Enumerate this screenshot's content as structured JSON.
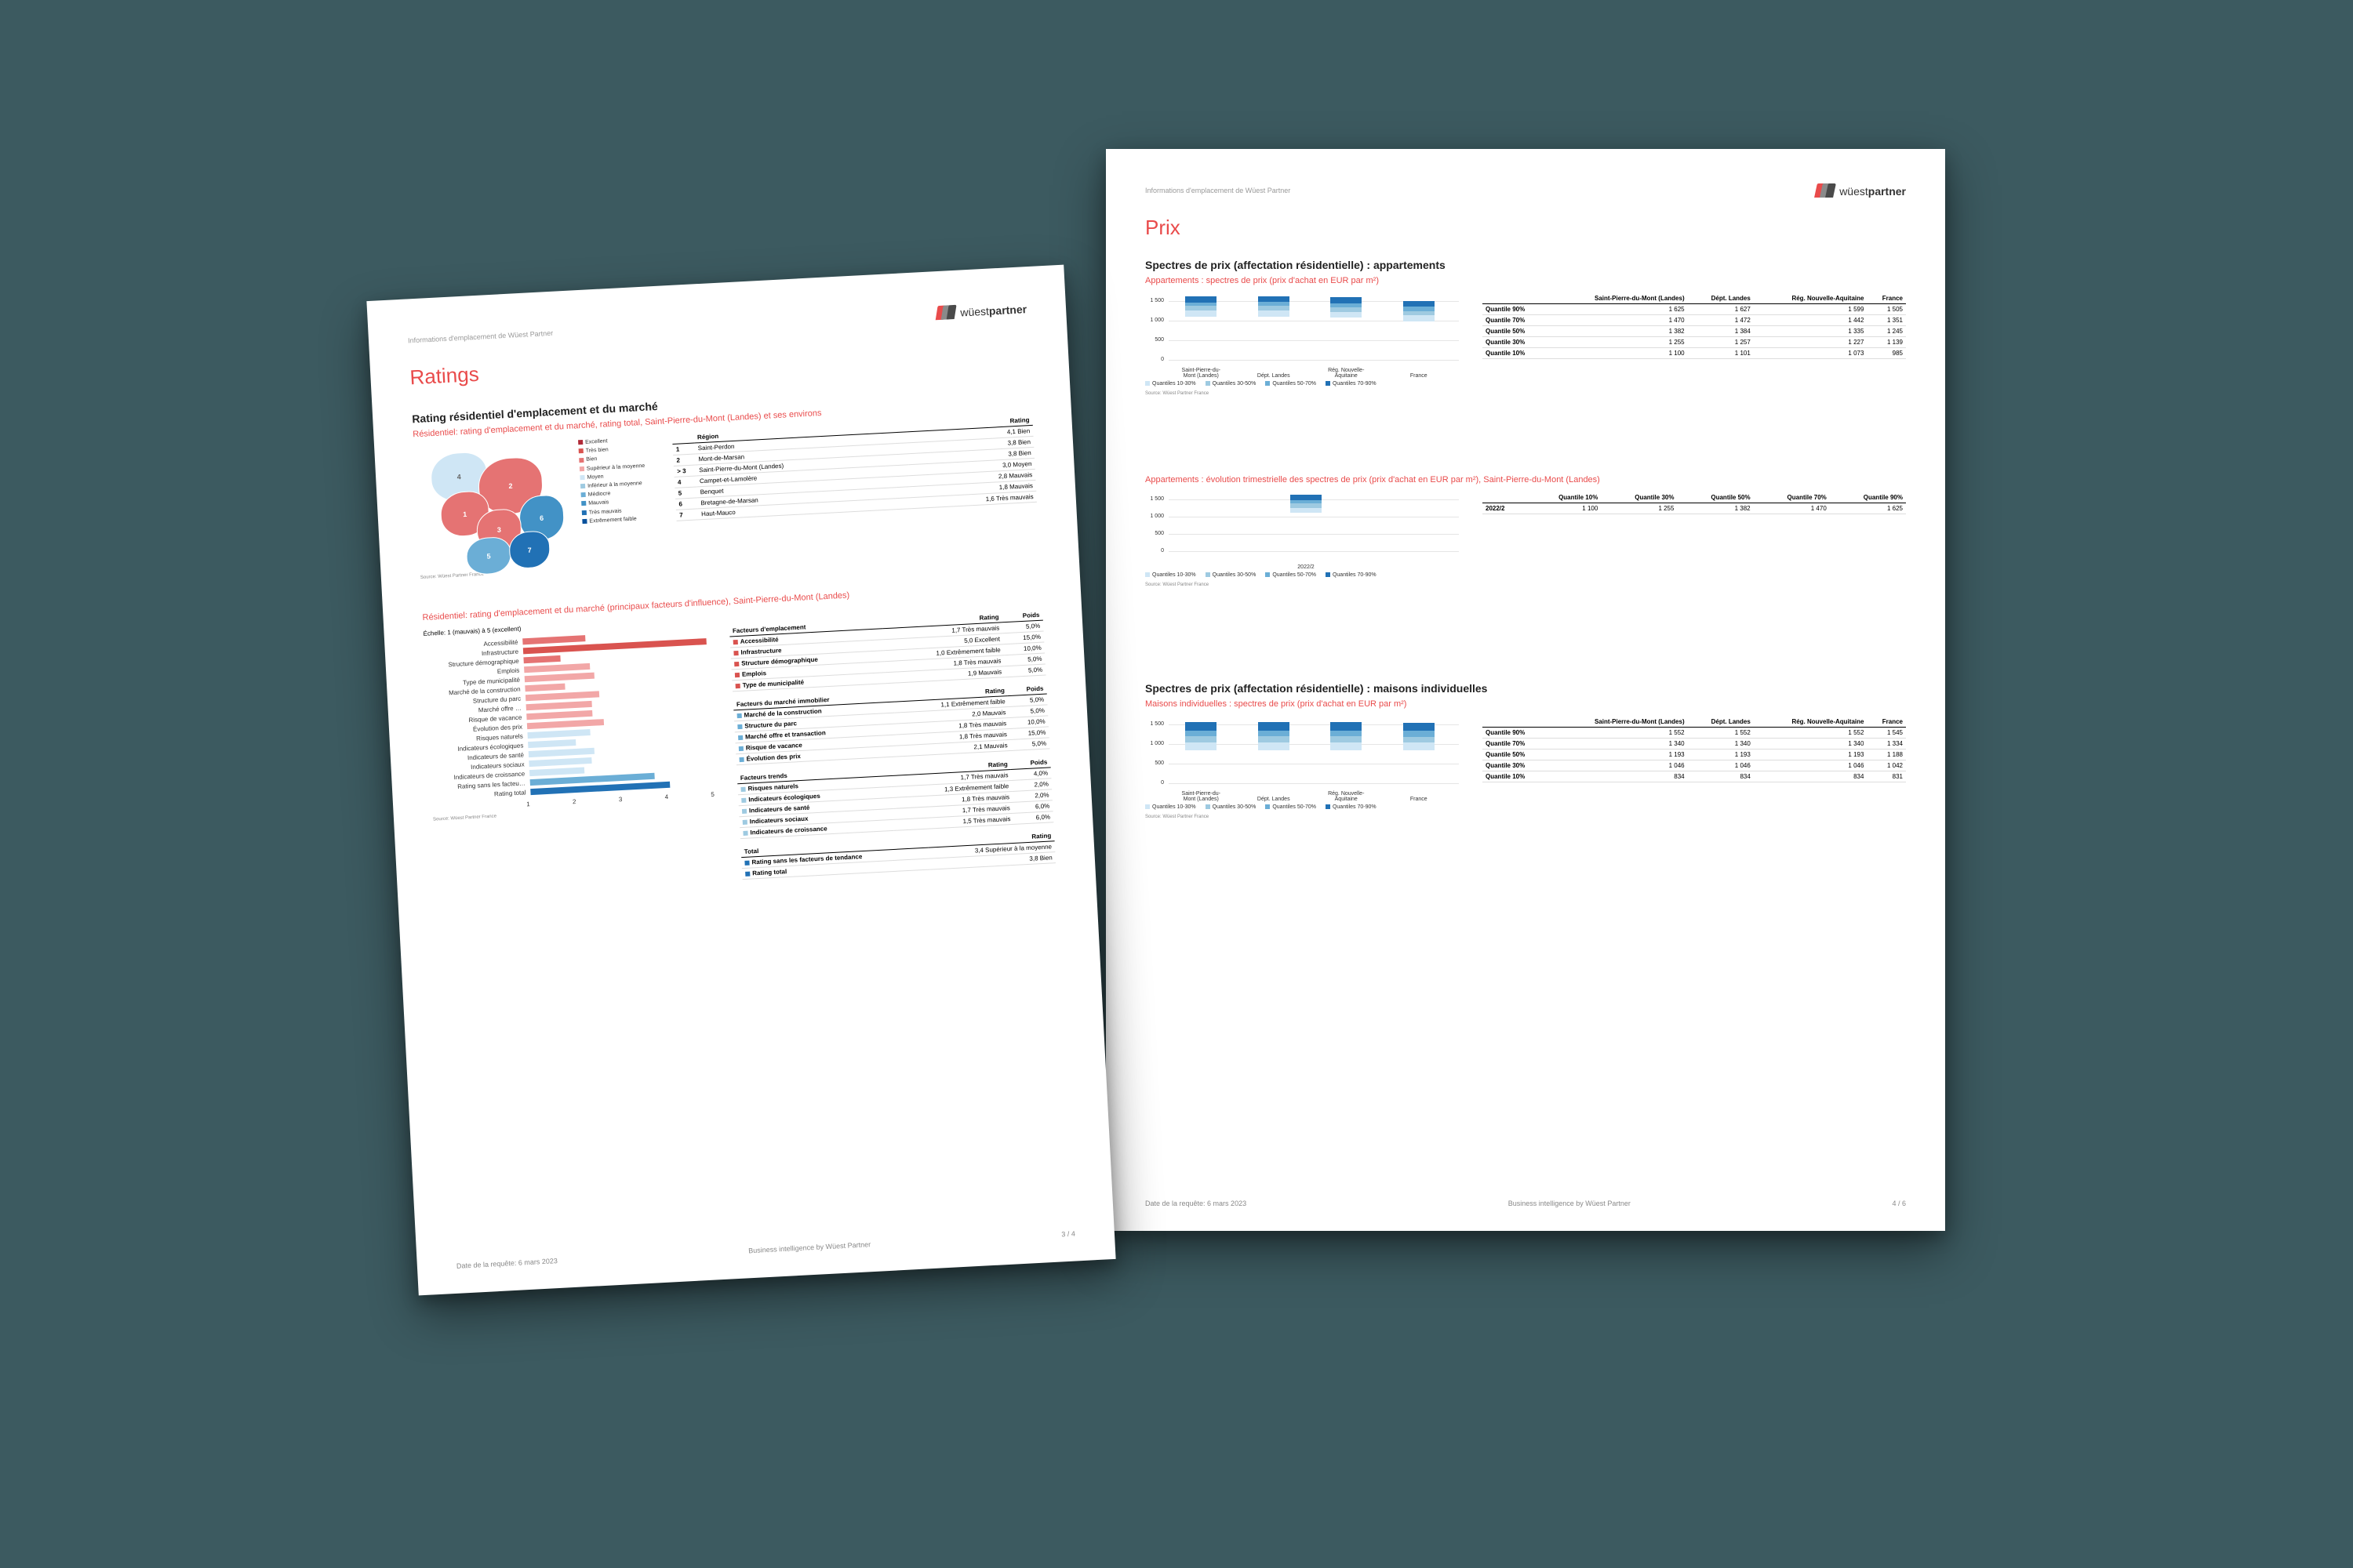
{
  "brand": {
    "name_light": "wüest",
    "name_bold": "partner"
  },
  "page1": {
    "header_note": "Informations d'emplacement de Wüest Partner",
    "title": "Ratings",
    "sec1_h2": "Rating résidentiel d'emplacement et du marché",
    "sec1_h3": "Résidentiel: rating d'emplacement et du marché, rating total, Saint-Pierre-du-Mont (Landes) et ses environs",
    "map_legend": [
      {
        "c": "#b02a37",
        "l": "Excellent"
      },
      {
        "c": "#d9534f",
        "l": "Très bien"
      },
      {
        "c": "#e57373",
        "l": "Bien"
      },
      {
        "c": "#f2a7a7",
        "l": "Supérieur à la moyenne"
      },
      {
        "c": "#cfe6f5",
        "l": "Moyen"
      },
      {
        "c": "#9ecae1",
        "l": "Inférieur à la moyenne"
      },
      {
        "c": "#6baed6",
        "l": "Médiocre"
      },
      {
        "c": "#4292c6",
        "l": "Mauvais"
      },
      {
        "c": "#2171b5",
        "l": "Très mauvais"
      },
      {
        "c": "#08519c",
        "l": "Extrêmement faible"
      }
    ],
    "region_table": {
      "cols": [
        "",
        "Région",
        "Rating"
      ],
      "rows": [
        [
          "1",
          "Saint-Perdon",
          "4,1 Bien"
        ],
        [
          "2",
          "Mont-de-Marsan",
          "3,8 Bien"
        ],
        [
          "> 3",
          "Saint-Pierre-du-Mont (Landes)",
          "3,8 Bien"
        ],
        [
          "4",
          "Campet-et-Lamolère",
          "3,0 Moyen"
        ],
        [
          "5",
          "Benquet",
          "2,8 Mauvais"
        ],
        [
          "6",
          "Bretagne-de-Marsan",
          "1,8 Mauvais"
        ],
        [
          "7",
          "Haut-Mauco",
          "1,6 Très mauvais"
        ]
      ]
    },
    "source": "Source: Wüest Partner France",
    "sec2_h3": "Résidentiel: rating d'emplacement et du marché (principaux facteurs d'influence), Saint-Pierre-du-Mont (Landes)",
    "scale_note": "Échelle: 1 (mauvais) à 5 (excellent)",
    "hbars": [
      {
        "l": "Accessibilité",
        "v": 1.7,
        "c": "#e57373"
      },
      {
        "l": "Infrastructure",
        "v": 5.0,
        "c": "#d9534f"
      },
      {
        "l": "Structure démographique",
        "v": 1.0,
        "c": "#e57373"
      },
      {
        "l": "Emplois",
        "v": 1.8,
        "c": "#f2a7a7"
      },
      {
        "l": "Type de municipalité",
        "v": 1.9,
        "c": "#f2a7a7"
      },
      {
        "l": "Marché de la construction",
        "v": 1.1,
        "c": "#f2a7a7"
      },
      {
        "l": "Structure du parc",
        "v": 2.0,
        "c": "#f2a7a7"
      },
      {
        "l": "Marché offre …",
        "v": 1.8,
        "c": "#f2a7a7"
      },
      {
        "l": "Risque de vacance",
        "v": 1.8,
        "c": "#f2a7a7"
      },
      {
        "l": "Évolution des prix",
        "v": 2.1,
        "c": "#f2a7a7"
      },
      {
        "l": "Risques naturels",
        "v": 1.7,
        "c": "#cfe6f5"
      },
      {
        "l": "Indicateurs écologiques",
        "v": 1.3,
        "c": "#cfe6f5"
      },
      {
        "l": "Indicateurs de santé",
        "v": 1.8,
        "c": "#cfe6f5"
      },
      {
        "l": "Indicateurs sociaux",
        "v": 1.7,
        "c": "#cfe6f5"
      },
      {
        "l": "Indicateurs de croissance",
        "v": 1.5,
        "c": "#cfe6f5"
      },
      {
        "l": "Rating sans les facteu…",
        "v": 3.4,
        "c": "#6baed6"
      },
      {
        "l": "Rating total",
        "v": 3.8,
        "c": "#2171b5"
      }
    ],
    "axis_ticks": [
      "1",
      "2",
      "3",
      "4",
      "5"
    ],
    "ft_emplacement": {
      "title": "Facteurs d'emplacement",
      "cols": [
        "",
        "Rating",
        "Poids"
      ],
      "rows": [
        {
          "c": "#d9534f",
          "l": "Accessibilité",
          "r": "1,7 Très mauvais",
          "p": "5,0%"
        },
        {
          "c": "#d9534f",
          "l": "Infrastructure",
          "r": "5,0 Excellent",
          "p": "15,0%"
        },
        {
          "c": "#d9534f",
          "l": "Structure démographique",
          "r": "1,0 Extrêmement faible",
          "p": "10,0%"
        },
        {
          "c": "#d9534f",
          "l": "Emplois",
          "r": "1,8 Très mauvais",
          "p": "5,0%"
        },
        {
          "c": "#d9534f",
          "l": "Type de municipalité",
          "r": "1,9 Mauvais",
          "p": "5,0%"
        }
      ]
    },
    "ft_marche": {
      "title": "Facteurs du marché immobilier",
      "cols": [
        "",
        "Rating",
        "Poids"
      ],
      "rows": [
        {
          "c": "#6baed6",
          "l": "Marché de la construction",
          "r": "1,1 Extrêmement faible",
          "p": "5,0%"
        },
        {
          "c": "#6baed6",
          "l": "Structure du parc",
          "r": "2,0 Mauvais",
          "p": "5,0%"
        },
        {
          "c": "#6baed6",
          "l": "Marché offre et transaction",
          "r": "1,8 Très mauvais",
          "p": "10,0%"
        },
        {
          "c": "#6baed6",
          "l": "Risque de vacance",
          "r": "1,8 Très mauvais",
          "p": "15,0%"
        },
        {
          "c": "#6baed6",
          "l": "Évolution des prix",
          "r": "2,1 Mauvais",
          "p": "5,0%"
        }
      ]
    },
    "ft_trends": {
      "title": "Facteurs trends",
      "cols": [
        "",
        "Rating",
        "Poids"
      ],
      "rows": [
        {
          "c": "#9ecae1",
          "l": "Risques naturels",
          "r": "1,7 Très mauvais",
          "p": "4,0%"
        },
        {
          "c": "#9ecae1",
          "l": "Indicateurs écologiques",
          "r": "1,3 Extrêmement faible",
          "p": "2,0%"
        },
        {
          "c": "#9ecae1",
          "l": "Indicateurs de santé",
          "r": "1,8 Très mauvais",
          "p": "2,0%"
        },
        {
          "c": "#9ecae1",
          "l": "Indicateurs sociaux",
          "r": "1,7 Très mauvais",
          "p": "6,0%"
        },
        {
          "c": "#9ecae1",
          "l": "Indicateurs de croissance",
          "r": "1,5 Très mauvais",
          "p": "6,0%"
        }
      ]
    },
    "ft_total": {
      "title": "Total",
      "cols": [
        "",
        "Rating"
      ],
      "rows": [
        {
          "c": "#2171b5",
          "l": "Rating sans les facteurs de tendance",
          "r": "3,4 Supérieur à la moyenne"
        },
        {
          "c": "#2171b5",
          "l": "Rating total",
          "r": "3,8 Bien"
        }
      ]
    },
    "footer": {
      "left": "Date de la requête: 6 mars 2023",
      "mid": "Business intelligence by Wüest Partner",
      "right": "3 / 4"
    }
  },
  "page2": {
    "header_note": "Informations d'emplacement de Wüest Partner",
    "title": "Prix",
    "secA_h2": "Spectres de prix (affectation résidentielle) : appartements",
    "secA_h3": "Appartements : spectres de prix (prix d'achat en EUR par m²)",
    "sp_cats": [
      "Saint-Pierre-du-Mont (Landes)",
      "Dépt. Landes",
      "Rég. Nouvelle-Aquitaine",
      "France"
    ],
    "sp_yticks": [
      "0",
      "500",
      "1 000",
      "1 500"
    ],
    "sp_legend": [
      {
        "c": "#cfe6f5",
        "l": "Quantiles 10-30%"
      },
      {
        "c": "#9ecae1",
        "l": "Quantiles 30-50%"
      },
      {
        "c": "#6baed6",
        "l": "Quantiles 50-70%"
      },
      {
        "c": "#2171b5",
        "l": "Quantiles 70-90%"
      }
    ],
    "tblA": {
      "cols": [
        "",
        "Saint-Pierre-du-Mont (Landes)",
        "Dépt. Landes",
        "Rég. Nouvelle-Aquitaine",
        "France"
      ],
      "rows": [
        [
          "Quantile 90%",
          "1 625",
          "1 627",
          "1 599",
          "1 505"
        ],
        [
          "Quantile 70%",
          "1 470",
          "1 472",
          "1 442",
          "1 351"
        ],
        [
          "Quantile 50%",
          "1 382",
          "1 384",
          "1 335",
          "1 245"
        ],
        [
          "Quantile 30%",
          "1 255",
          "1 257",
          "1 227",
          "1 139"
        ],
        [
          "Quantile 10%",
          "1 100",
          "1 101",
          "1 073",
          "985"
        ]
      ]
    },
    "secB_h3": "Appartements : évolution trimestrielle des spectres de prix (prix d'achat en EUR par m²), Saint-Pierre-du-Mont (Landes)",
    "tblB": {
      "cols": [
        "",
        "Quantile 10%",
        "Quantile 30%",
        "Quantile 50%",
        "Quantile 70%",
        "Quantile 90%"
      ],
      "rows": [
        [
          "2022/2",
          "1 100",
          "1 255",
          "1 382",
          "1 470",
          "1 625"
        ]
      ]
    },
    "evo_x": "2022/2",
    "secC_h2": "Spectres de prix (affectation résidentielle) : maisons individuelles",
    "secC_h3": "Maisons individuelles : spectres de prix (prix d'achat en EUR par m²)",
    "tblC": {
      "cols": [
        "",
        "Saint-Pierre-du-Mont (Landes)",
        "Dépt. Landes",
        "Rég. Nouvelle-Aquitaine",
        "France"
      ],
      "rows": [
        [
          "Quantile 90%",
          "1 552",
          "1 552",
          "1 552",
          "1 545"
        ],
        [
          "Quantile 70%",
          "1 340",
          "1 340",
          "1 340",
          "1 334"
        ],
        [
          "Quantile 50%",
          "1 193",
          "1 193",
          "1 193",
          "1 188"
        ],
        [
          "Quantile 30%",
          "1 046",
          "1 046",
          "1 046",
          "1 042"
        ],
        [
          "Quantile 10%",
          "834",
          "834",
          "834",
          "831"
        ]
      ]
    },
    "source": "Source: Wüest Partner France",
    "footer": {
      "left": "Date de la requête: 6 mars 2023",
      "mid": "Business intelligence by Wüest Partner",
      "right": "4 / 6"
    }
  },
  "chart_data": [
    {
      "type": "bar",
      "orientation": "horizontal",
      "title": "Rating factors",
      "xlim": [
        1,
        5
      ],
      "categories": [
        "Accessibilité",
        "Infrastructure",
        "Structure démographique",
        "Emplois",
        "Type de municipalité",
        "Marché de la construction",
        "Structure du parc",
        "Marché offre",
        "Risque de vacance",
        "Évolution des prix",
        "Risques naturels",
        "Indicateurs écologiques",
        "Indicateurs de santé",
        "Indicateurs sociaux",
        "Indicateurs de croissance",
        "Rating sans les facteurs",
        "Rating total"
      ],
      "values": [
        1.7,
        5.0,
        1.0,
        1.8,
        1.9,
        1.1,
        2.0,
        1.8,
        1.8,
        2.1,
        1.7,
        1.3,
        1.8,
        1.7,
        1.5,
        3.4,
        3.8
      ]
    },
    {
      "type": "boxlike",
      "title": "Appartements spectres de prix EUR/m²",
      "ylim": [
        0,
        1700
      ],
      "categories": [
        "Saint-Pierre-du-Mont (Landes)",
        "Dépt. Landes",
        "Rég. Nouvelle-Aquitaine",
        "France"
      ],
      "series": [
        {
          "name": "Q10",
          "values": [
            1100,
            1101,
            1073,
            985
          ]
        },
        {
          "name": "Q30",
          "values": [
            1255,
            1257,
            1227,
            1139
          ]
        },
        {
          "name": "Q50",
          "values": [
            1382,
            1384,
            1335,
            1245
          ]
        },
        {
          "name": "Q70",
          "values": [
            1470,
            1472,
            1442,
            1351
          ]
        },
        {
          "name": "Q90",
          "values": [
            1625,
            1627,
            1599,
            1505
          ]
        }
      ]
    },
    {
      "type": "boxlike",
      "title": "Évolution trimestrielle appartements",
      "ylim": [
        0,
        1700
      ],
      "categories": [
        "2022/2"
      ],
      "series": [
        {
          "name": "Q10",
          "values": [
            1100
          ]
        },
        {
          "name": "Q30",
          "values": [
            1255
          ]
        },
        {
          "name": "Q50",
          "values": [
            1382
          ]
        },
        {
          "name": "Q70",
          "values": [
            1470
          ]
        },
        {
          "name": "Q90",
          "values": [
            1625
          ]
        }
      ]
    },
    {
      "type": "boxlike",
      "title": "Maisons individuelles spectres de prix EUR/m²",
      "ylim": [
        0,
        1700
      ],
      "categories": [
        "Saint-Pierre-du-Mont (Landes)",
        "Dépt. Landes",
        "Rég. Nouvelle-Aquitaine",
        "France"
      ],
      "series": [
        {
          "name": "Q10",
          "values": [
            834,
            834,
            834,
            831
          ]
        },
        {
          "name": "Q30",
          "values": [
            1046,
            1046,
            1046,
            1042
          ]
        },
        {
          "name": "Q50",
          "values": [
            1193,
            1193,
            1193,
            1188
          ]
        },
        {
          "name": "Q70",
          "values": [
            1340,
            1340,
            1340,
            1334
          ]
        },
        {
          "name": "Q90",
          "values": [
            1552,
            1552,
            1552,
            1545
          ]
        }
      ]
    }
  ]
}
